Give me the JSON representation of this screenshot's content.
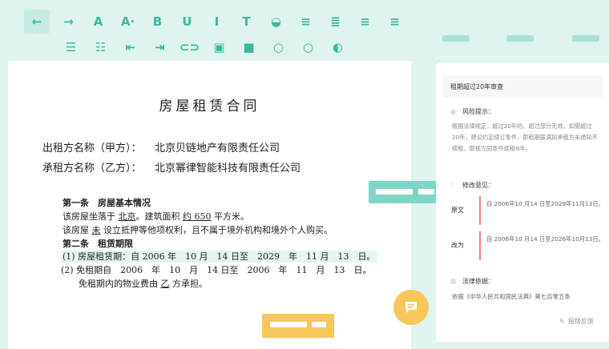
{
  "toolbar": {
    "row1": [
      {
        "name": "back-arrow-icon",
        "glyph": "←"
      },
      {
        "name": "forward-arrow-icon",
        "glyph": "→"
      },
      {
        "name": "font-color-icon",
        "glyph": "A"
      },
      {
        "name": "font-size-icon",
        "glyph": "A·"
      },
      {
        "name": "bold-icon",
        "glyph": "B"
      },
      {
        "name": "underline-icon",
        "glyph": "U"
      },
      {
        "name": "italic-icon",
        "glyph": "I"
      },
      {
        "name": "strikethrough-icon",
        "glyph": "T"
      },
      {
        "name": "highlight-icon",
        "glyph": "◒"
      },
      {
        "name": "align-center-icon",
        "glyph": "≡"
      },
      {
        "name": "align-justify-icon",
        "glyph": "≣"
      },
      {
        "name": "align-left-icon",
        "glyph": "≡"
      },
      {
        "name": "align-right-icon",
        "glyph": "≡"
      }
    ],
    "row2": [
      {
        "name": "bullet-list-icon",
        "glyph": "☰"
      },
      {
        "name": "numbered-list-icon",
        "glyph": "☷"
      },
      {
        "name": "indent-decrease-icon",
        "glyph": "⇤"
      },
      {
        "name": "indent-increase-icon",
        "glyph": "⇥"
      },
      {
        "name": "link-icon",
        "glyph": "⊂⊃"
      },
      {
        "name": "image-icon",
        "glyph": "▣"
      },
      {
        "name": "video-icon",
        "glyph": "■"
      },
      {
        "name": "circle-icon",
        "glyph": "○"
      },
      {
        "name": "radio-icon",
        "glyph": "○"
      },
      {
        "name": "toggle-icon",
        "glyph": "◐"
      }
    ]
  },
  "document": {
    "title": "房屋租赁合同",
    "lessor_label": "出租方名称（甲方）：",
    "lessor_value": "北京贝链地产有限责任公司",
    "lessee_label": "承租方名称（乙方）：",
    "lessee_value": "北京幂律智能科技有限责任公司",
    "art1_title": "第一条　房屋基本情况",
    "art1_l1_a": "该房屋坐落于",
    "art1_l1_loc": "北京",
    "art1_l1_b": "。建筑面积",
    "art1_l1_area": "约 650",
    "art1_l1_c": "平方米。",
    "art1_l2_a": "该房屋",
    "art1_l2_val": "未",
    "art1_l2_b": "设立抵押等他项权利，且不属于境外机构和境外个人购买。",
    "art2_title": "第二条　租赁期限",
    "art2_l1": "(1) 房屋租赁期：自 2006 年　10 月　14 日至　2029　年　11 月　13　日。",
    "art2_l2": "(2) 免租期自　2006　年　10　月　14 日至　2006　年　11　月　13　日。",
    "art2_l3_a": "免租期内的物业费由",
    "art2_l3_val": "乙",
    "art2_l3_b": "方承担。"
  },
  "panel": {
    "heading": "租期超过20年审查",
    "risk_title": "风险提示：",
    "risk_text": "根据法律规定，超过20年的，超过部分无效。如需超过20年，建议约定续订条件，即租期届满如承租方未通知不续租，即视为同条件续租N年。",
    "revise_title": "修改意见：",
    "orig_label": "原文",
    "orig_text": "自 2006年10 月14 日至2029年11月13日。",
    "change_label": "改为",
    "change_text": "自 2006年10 月14 日至2026年10月13日。",
    "law_title": "法律依据：",
    "law_text": "依据《中华人民共和国民法典》第七百零五条",
    "feedback": "报错反馈"
  },
  "colors": {
    "accent": "#39b89e",
    "mint": "#7fd6c6",
    "yellow": "#f7c75a",
    "revision": "#f08080"
  }
}
